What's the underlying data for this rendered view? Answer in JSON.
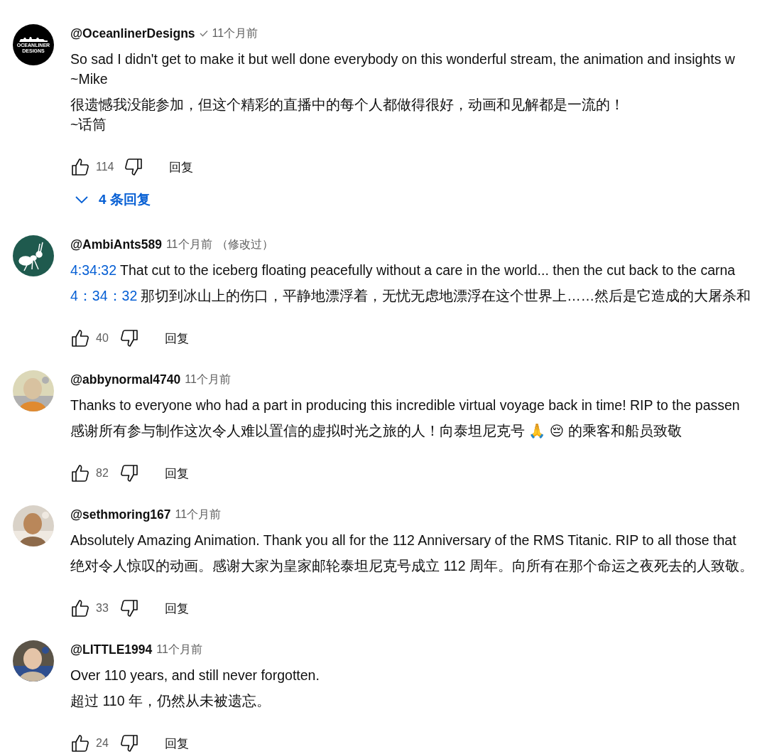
{
  "comments": [
    {
      "avatar": {
        "kind": "logo",
        "lines": [
          "OCEANLINER",
          "DESIGNS"
        ]
      },
      "handle": "@OceanlinerDesigns",
      "verified": true,
      "time": "11个月前",
      "paragraphs": [
        {
          "lines": [
            {
              "text": "So sad I didn't get to make it but well done everybody on this wonderful stream, the animation and insights w"
            },
            {
              "text": "~Mike"
            }
          ]
        },
        {
          "lines": [
            {
              "text": "很遗憾我没能参加，但这个精彩的直播中的每个人都做得很好，动画和见解都是一流的！"
            },
            {
              "text": "~话筒"
            }
          ]
        }
      ],
      "likes": "114",
      "reply": "回复",
      "replies": "4 条回复"
    },
    {
      "avatar": {
        "kind": "ant"
      },
      "handle": "@AmbiAnts589",
      "verified": false,
      "time": "11个月前",
      "edited_note": "（修改过）",
      "paragraphs": [
        {
          "lines": [
            {
              "timestamp": "4:34:32",
              "text": "That cut to the iceberg floating peacefully without a care in the world... then the cut back to the carna"
            }
          ]
        },
        {
          "lines": [
            {
              "timestamp": "4：34：32",
              "text": "那切到冰山上的伤口，平静地漂浮着，无忧无虑地漂浮在这个世界上……然后是它造成的大屠杀和"
            }
          ]
        }
      ],
      "likes": "40",
      "reply": "回复"
    },
    {
      "handle": "@abbynormal4740",
      "verified": false,
      "time": "11个月前",
      "paragraphs": [
        {
          "lines": [
            {
              "text": "Thanks to everyone who had a part in producing this incredible virtual voyage back in time! RIP to the passen"
            }
          ]
        },
        {
          "lines": [
            {
              "text": "感谢所有参与制作这次令人难以置信的虚拟时光之旅的人！向泰坦尼克号 🙏  😔 的乘客和船员致敬"
            }
          ]
        }
      ],
      "likes": "82",
      "reply": "回复"
    },
    {
      "handle": "@sethmoring167",
      "verified": false,
      "time": "11个月前",
      "paragraphs": [
        {
          "lines": [
            {
              "text": "Absolutely Amazing Animation. Thank you all for the 112 Anniversary of the RMS Titanic. RIP to all those that"
            }
          ]
        },
        {
          "lines": [
            {
              "text": "绝对令人惊叹的动画。感谢大家为皇家邮轮泰坦尼克号成立 112 周年。向所有在那个命运之夜死去的人致敬。"
            }
          ]
        }
      ],
      "likes": "33",
      "reply": "回复"
    },
    {
      "handle": "@LITTLE1994",
      "verified": false,
      "time": "11个月前",
      "paragraphs": [
        {
          "lines": [
            {
              "text": "Over 110 years, and still never forgotten."
            }
          ]
        },
        {
          "lines": [
            {
              "text": "超过 110 年，仍然从未被遗忘。"
            }
          ]
        }
      ],
      "likes": "24",
      "reply": "回复"
    }
  ]
}
